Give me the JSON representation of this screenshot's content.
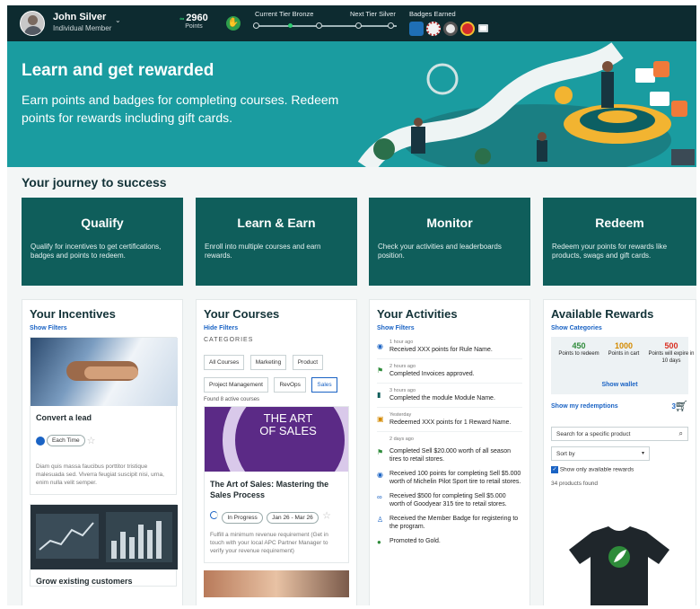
{
  "user": {
    "name": "John Silver",
    "role": "Individual Member"
  },
  "points": {
    "value": "2960",
    "label": "Points"
  },
  "tiers": {
    "current": "Current Tier Bronze",
    "next": "Next Tier Silver",
    "badges_label": "Badges Earned"
  },
  "hero": {
    "title": "Learn and get rewarded",
    "subtitle": "Earn points and badges for completing courses. Redeem points for rewards including gift cards."
  },
  "journey": {
    "title": "Your journey to success",
    "cards": [
      {
        "title": "Qualify",
        "text": "Qualify for incentives to get certifications, badges and points to redeem."
      },
      {
        "title": "Learn & Earn",
        "text": "Enroll into multiple courses and earn rewards."
      },
      {
        "title": "Monitor",
        "text": "Check your activities and leaderboards position."
      },
      {
        "title": "Redeem",
        "text": "Redeem your points for rewards like products, swags and gift cards."
      }
    ]
  },
  "incentives": {
    "title": "Your Incentives",
    "filter": "Show Filters",
    "card1": {
      "title": "Convert a lead",
      "pill": "Each Time",
      "text": "Diam quis massa faucibus porttitor tristique malesuada sed. Viverra feugiat suscipit nisi, urna, enim nulla velit semper."
    },
    "card2": {
      "title": "Grow existing customers"
    }
  },
  "courses": {
    "title": "Your Courses",
    "filter": "Hide Filters",
    "categories_label": "CATEGORIES",
    "chips": [
      "All Courses",
      "Marketing",
      "Product",
      "Project Management",
      "RevOps",
      "Sales"
    ],
    "found": "Found 8 active courses",
    "banner": "THE ART OF SALES",
    "course_title": "The Art of Sales: Mastering the Sales Process",
    "status": "In Progress",
    "dates": "Jan 26 - Mar 26",
    "desc": "Fulfill a minimum revenue requirement (Get in touch with your local APC Partner Manager to verify your revenue requirement)"
  },
  "activities": {
    "title": "Your Activities",
    "filter": "Show Filters",
    "items": [
      {
        "time": "1 hour ago",
        "text": "Received XXX points for Rule Name."
      },
      {
        "time": "2 hours ago",
        "text": "Completed Invoices approved."
      },
      {
        "time": "3 hours ago",
        "text": "Completed the module Module Name."
      },
      {
        "time": "Yesterday",
        "text": "Redeemed XXX points for 1 Reward Name."
      },
      {
        "time": "2 days ago",
        "text": ""
      },
      {
        "time": "",
        "text": "Completed Sell $20.000 worth of all season tires to retail stores."
      },
      {
        "time": "",
        "text": "Received 100 points for completing Sell $5.000 worth of Michelin Pilot Sport tire to retail stores."
      },
      {
        "time": "",
        "text": "Received $500 for completing Sell $5.000 worth of Goodyear 315 tire to retail stores."
      },
      {
        "time": "",
        "text": "Received the Member Badge for registering to the program."
      },
      {
        "time": "",
        "text": "Promoted to Gold."
      }
    ]
  },
  "rewards": {
    "title": "Available Rewards",
    "categories": "Show Categories",
    "redeem": {
      "value": "450",
      "label": "Points to redeem"
    },
    "cart": {
      "value": "1000",
      "label": "Points in cart"
    },
    "expire": {
      "value": "500",
      "label": "Points will expire in 10 days"
    },
    "wallet": "Show wallet",
    "redemptions": "Show my redemptions",
    "cart_count": "3",
    "search_placeholder": "Search for a specific product",
    "sort": "Sort by",
    "only_available": "Show only available rewards",
    "found": "34 products found"
  },
  "colors": {
    "dark": "#0d2b30",
    "teal": "#1a9ca0",
    "card": "#0f5e5b",
    "link": "#1a63c4",
    "redeem": "#2e8b3a",
    "cart": "#d48a00",
    "expire": "#d92d20"
  }
}
